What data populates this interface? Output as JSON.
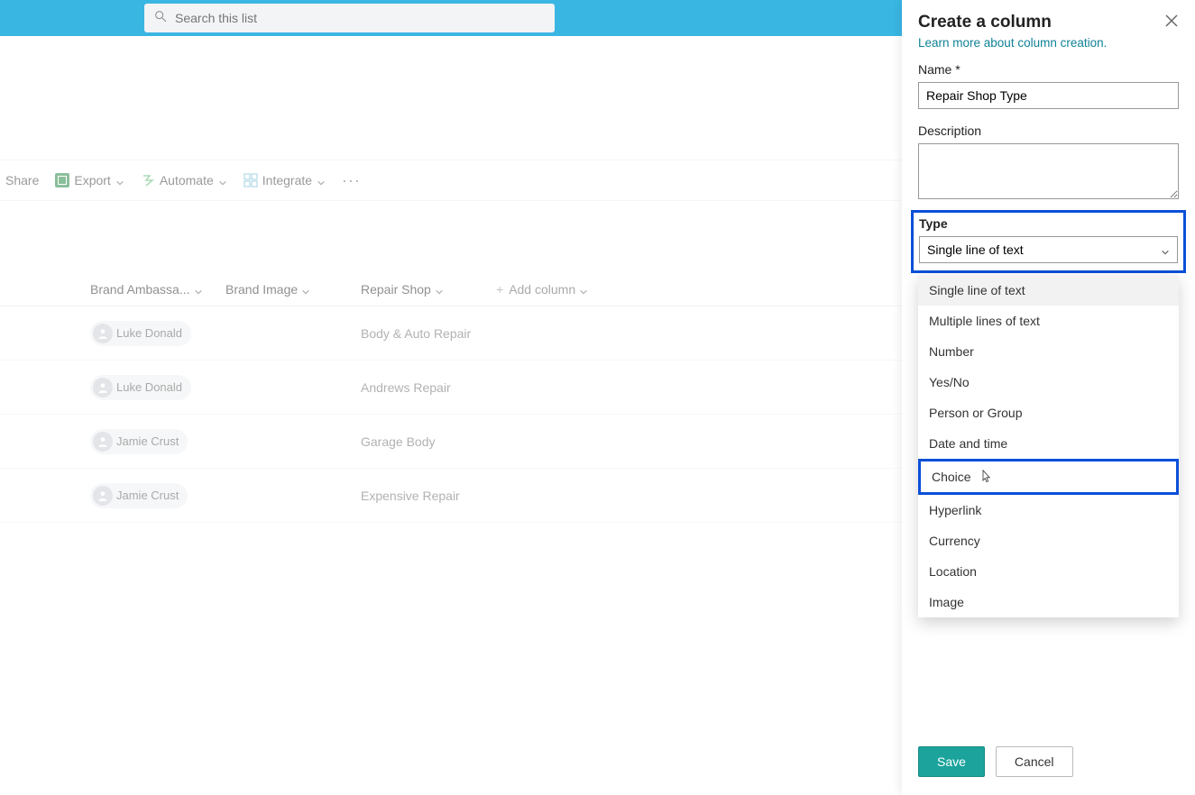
{
  "search": {
    "placeholder": "Search this list"
  },
  "commands": {
    "share": "Share",
    "export": "Export",
    "automate": "Automate",
    "integrate": "Integrate"
  },
  "columns": {
    "brandAmbassador": "Brand Ambassa...",
    "brandImage": "Brand Image",
    "repairShop": "Repair Shop",
    "addColumn": "Add column"
  },
  "rows": [
    {
      "person": "Luke Donald",
      "repairShop": "Body & Auto Repair"
    },
    {
      "person": "Luke Donald",
      "repairShop": "Andrews Repair"
    },
    {
      "person": "Jamie Crust",
      "repairShop": "Garage Body"
    },
    {
      "person": "Jamie Crust",
      "repairShop": "Expensive Repair"
    }
  ],
  "panel": {
    "title": "Create a column",
    "learnMore": "Learn more about column creation.",
    "nameLabel": "Name *",
    "nameValue": "Repair Shop Type",
    "descriptionLabel": "Description",
    "typeLabel": "Type",
    "typeSelected": "Single line of text",
    "typeOptions": [
      "Single line of text",
      "Multiple lines of text",
      "Number",
      "Yes/No",
      "Person or Group",
      "Date and time",
      "Choice",
      "Hyperlink",
      "Currency",
      "Location",
      "Image"
    ],
    "save": "Save",
    "cancel": "Cancel"
  }
}
